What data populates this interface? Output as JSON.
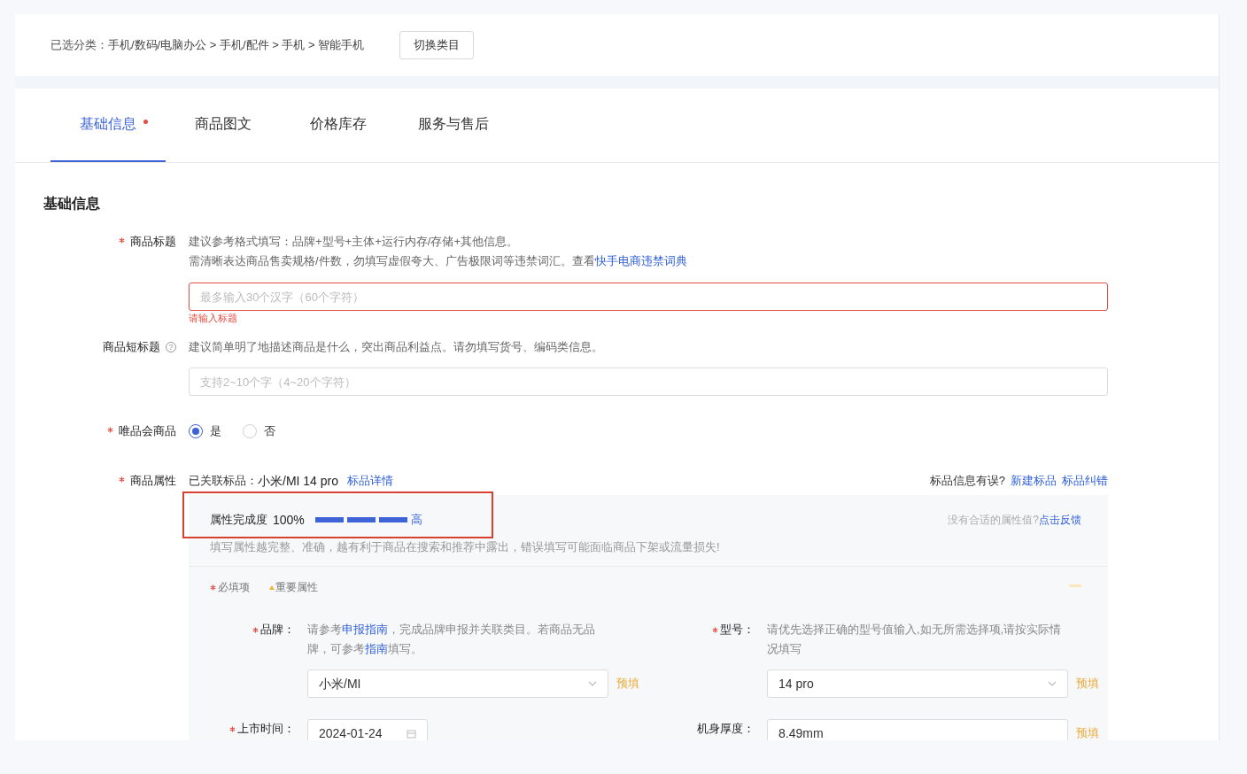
{
  "breadcrumb": {
    "label": "已选分类：",
    "path": "手机/数码/电脑办公 > 手机/配件 > 手机 > 智能手机",
    "button": "切换类目"
  },
  "tabs": [
    {
      "label": "基础信息",
      "selected": true,
      "alert": true
    },
    {
      "label": "商品图文",
      "selected": false,
      "alert": false
    },
    {
      "label": "价格库存",
      "selected": false,
      "alert": false
    },
    {
      "label": "服务与售后",
      "selected": false,
      "alert": false
    }
  ],
  "section_title": "基础信息",
  "title_field": {
    "label": "商品标题",
    "required": true,
    "hint_1": "建议参考格式填写：品牌+型号+主体+运行内存/存储+其他信息。",
    "hint_2": "需清晰表达商品售卖规格/件数，勿填写虚假夸大、广告极限词等违禁词汇。查看",
    "link": "快手电商违禁词典",
    "placeholder": "最多输入30个汉字（60个字符）",
    "error": "请输入标题"
  },
  "short_title_field": {
    "label": "商品短标题",
    "required": false,
    "help": "?",
    "hint": "建议简单明了地描述商品是什么，突出商品利益点。请勿填写货号、编码类信息。",
    "placeholder": "支持2~10个字（4~20个字符）"
  },
  "vip_field": {
    "label": "唯品会商品",
    "required": true,
    "options": [
      {
        "label": "是",
        "selected": true
      },
      {
        "label": "否",
        "selected": false
      }
    ]
  },
  "attributes": {
    "label": "商品属性",
    "required": true,
    "linked_label": "已关联标品：",
    "linked_value": "小米/MI 14 pro",
    "detail_link": "标品详情",
    "error_question": "标品信息有误?",
    "links": [
      "新建标品",
      "标品纠错"
    ],
    "completion": {
      "label": "属性完成度",
      "percent": "100%",
      "level": 1,
      "rating": "高",
      "highlighted": true
    },
    "feedback_question": "没有合适的属性值?",
    "feedback_link": "点击反馈",
    "note": "填写属性越完整、准确，越有利于商品在搜索和推荐中露出，错误填写可能面临商品下架或流量损失!",
    "legend": [
      {
        "kind": "required",
        "label": "必填项"
      },
      {
        "kind": "important",
        "label": "重要属性"
      }
    ],
    "fields": [
      {
        "label": "品牌：",
        "required": true,
        "hint": "请参考**申报指南**，完成品牌申报并关联类目。若商品无品牌，可参考**指南**填写。",
        "kind": "select",
        "value": "小米/MI",
        "prefill": "预填"
      },
      {
        "label": "型号：",
        "required": true,
        "hint": "请优先选择正确的型号值输入,如无所需选择项,请按实际情况填写",
        "kind": "select",
        "value": "14 pro",
        "prefill": "预填"
      },
      {
        "label": "上市时间：",
        "required": true,
        "kind": "date",
        "value": "2024-01-24"
      },
      {
        "label": "机身厚度：",
        "required": false,
        "kind": "text",
        "value": "8.49mm",
        "prefill": "预填"
      }
    ]
  }
}
